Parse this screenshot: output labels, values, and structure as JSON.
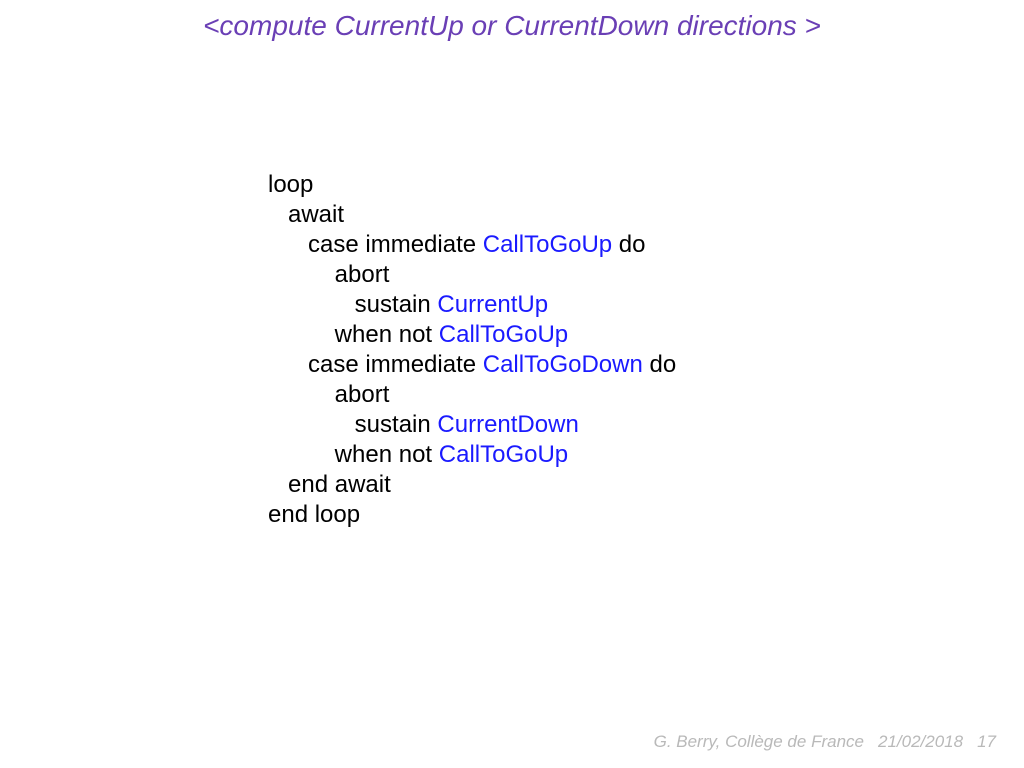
{
  "title": "<compute CurrentUp or CurrentDown directions >",
  "code": {
    "l1": "loop",
    "l2": "   await",
    "l3a": "      case immediate ",
    "l3b": "CallToGoUp",
    "l3c": " do",
    "l4": "          abort",
    "l5a": "             sustain ",
    "l5b": "CurrentUp",
    "l6a": "          when not ",
    "l6b": "CallToGoUp",
    "l7a": "      case immediate ",
    "l7b": "CallToGoDown",
    "l7c": " do",
    "l8": "          abort",
    "l9a": "             sustain ",
    "l9b": "CurrentDown",
    "l10a": "          when not ",
    "l10b": "CallToGoUp",
    "l11": "   end await",
    "l12": "end loop"
  },
  "footer": {
    "author": "G. Berry, Collège de France",
    "date": "21/02/2018",
    "page": "17"
  }
}
